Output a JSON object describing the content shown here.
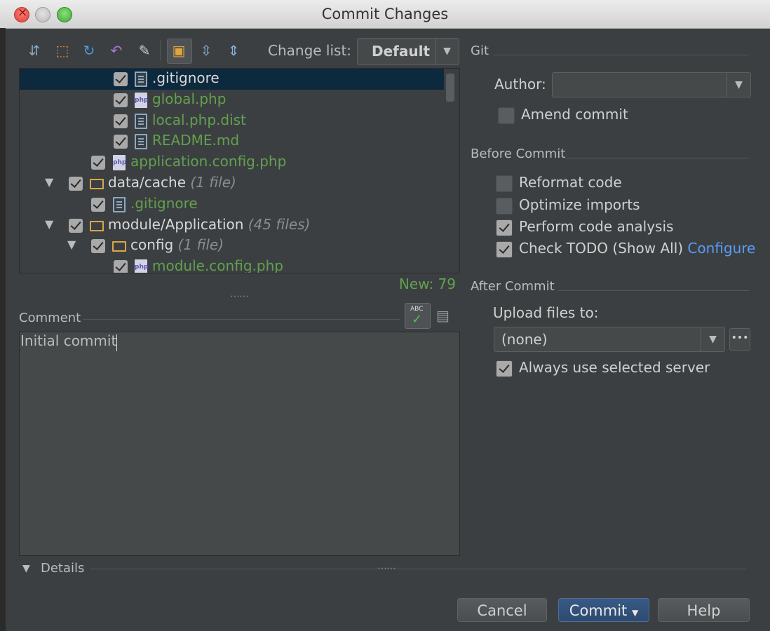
{
  "window": {
    "title": "Commit Changes"
  },
  "toolbar": {
    "icons": [
      "commit-diff-icon",
      "move-to-changelist-icon",
      "refresh-icon",
      "rollback-icon",
      "edit-source-icon",
      "group-by-directory-icon",
      "expand-all-icon",
      "collapse-all-icon"
    ],
    "changelist_label": "Change list:",
    "changelist_value": "Default"
  },
  "tree": {
    "rows": [
      {
        "name": ".gitignore",
        "icon": "text-file-icon",
        "color": "#d8d8d8",
        "checked": true,
        "selected": true
      },
      {
        "name": "global.php",
        "icon": "php-file-icon",
        "color": "#62a04f",
        "checked": true
      },
      {
        "name": "local.php.dist",
        "icon": "text-file-icon",
        "color": "#62a04f",
        "checked": true
      },
      {
        "name": "README.md",
        "icon": "text-file-icon",
        "color": "#62a04f",
        "checked": true
      },
      {
        "name": "application.config.php",
        "icon": "php-file-icon",
        "color": "#62a04f",
        "checked": true
      },
      {
        "name": "data/cache",
        "count": "(1 file)",
        "icon": "folder-icon",
        "checked": true
      },
      {
        "name": ".gitignore",
        "icon": "text-file-icon",
        "color": "#62a04f",
        "checked": true
      },
      {
        "name": "module/Application",
        "count": "(45 files)",
        "icon": "folder-icon",
        "checked": true
      },
      {
        "name": "config",
        "count": "(1 file)",
        "icon": "folder-icon",
        "checked": true
      },
      {
        "name": "module.config.php",
        "icon": "php-file-icon",
        "color": "#62a04f",
        "checked": true
      }
    ],
    "status": "New: 79"
  },
  "comment": {
    "label": "Comment",
    "text": "Initial commit"
  },
  "git": {
    "section": "Git",
    "author_label": "Author:",
    "author_value": "",
    "amend_label": "Amend commit",
    "amend_checked": false
  },
  "before_commit": {
    "section": "Before Commit",
    "reformat": "Reformat code",
    "optimize": "Optimize imports",
    "analysis": "Perform code analysis",
    "todo": "Check TODO (Show All)",
    "configure": "Configure"
  },
  "after_commit": {
    "section": "After Commit",
    "upload_label": "Upload files to:",
    "upload_value": "(none)",
    "always_server": "Always use selected server"
  },
  "details": {
    "label": "Details"
  },
  "buttons": {
    "cancel": "Cancel",
    "commit": "Commit",
    "help": "Help"
  },
  "colors": {
    "background": "#3c3f41",
    "selection": "#0d293e",
    "added_file": "#62a04f",
    "link": "#589df6"
  }
}
